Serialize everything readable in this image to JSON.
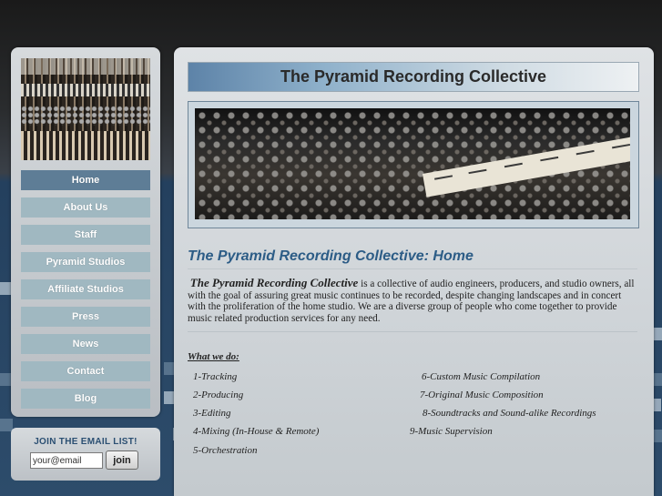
{
  "site": {
    "title": "The Pyramid Recording Collective"
  },
  "sidebar": {
    "nav": [
      {
        "label": "Home",
        "active": true
      },
      {
        "label": "About Us"
      },
      {
        "label": "Staff"
      },
      {
        "label": "Pyramid Studios"
      },
      {
        "label": "Affiliate Studios"
      },
      {
        "label": "Press"
      },
      {
        "label": "News"
      },
      {
        "label": "Contact"
      },
      {
        "label": "Blog"
      }
    ]
  },
  "email_signup": {
    "title": "JOIN THE EMAIL LIST!",
    "input_value": "your@email",
    "button_label": "join"
  },
  "main": {
    "page_heading": "The Pyramid Recording Collective: Home",
    "intro_brand": "The Pyramid Recording Collective",
    "intro_text": " is a collective of audio engineers, producers, and studio owners, all with the goal of assuring great music continues to be recorded, despite changing landscapes and in concert with the proliferation of the home studio. We are a diverse group of people who come together to provide music related production services for any need.",
    "what_we_do_heading": "What we do:",
    "services_left": [
      "1-Tracking",
      "2-Producing",
      "3-Editing",
      "4-Mixing (In-House & Remote)",
      "5-Orchestration"
    ],
    "services_right": [
      "6-Custom Music Compilation",
      "7-Original Music Composition",
      "8-Soundtracks and Sound-alike Recordings",
      "9-Music Supervision"
    ]
  },
  "colors": {
    "nav_active": "#5e7d96",
    "nav_default": "#a0b8c1",
    "heading_blue": "#2c5c86"
  }
}
